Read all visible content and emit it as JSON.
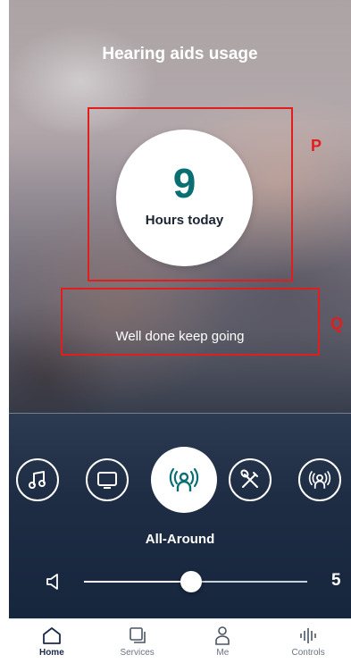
{
  "header": {
    "title": "Hearing aids usage"
  },
  "usage": {
    "hours": "9",
    "label": "Hours today"
  },
  "message": "Well done keep going",
  "annotations": {
    "p": "P",
    "q": "Q"
  },
  "programs": {
    "items": [
      {
        "name": "music",
        "icon": "music-note-icon"
      },
      {
        "name": "tv",
        "icon": "tv-icon"
      },
      {
        "name": "All-Around",
        "icon": "all-around-icon",
        "active": true
      },
      {
        "name": "restaurant",
        "icon": "fork-knife-icon"
      },
      {
        "name": "speech",
        "icon": "speech-focus-icon"
      }
    ],
    "selected_label": "All-Around"
  },
  "volume": {
    "value": "5",
    "level_fraction": 0.48
  },
  "tabs": [
    {
      "label": "Home",
      "icon": "home-icon",
      "selected": true
    },
    {
      "label": "Services",
      "icon": "services-icon"
    },
    {
      "label": "Me",
      "icon": "person-icon"
    },
    {
      "label": "Controls",
      "icon": "controls-icon"
    }
  ],
  "colors": {
    "accent": "#0a6f73",
    "panel": "#1e2d44",
    "annotation": "#e21d1d"
  }
}
